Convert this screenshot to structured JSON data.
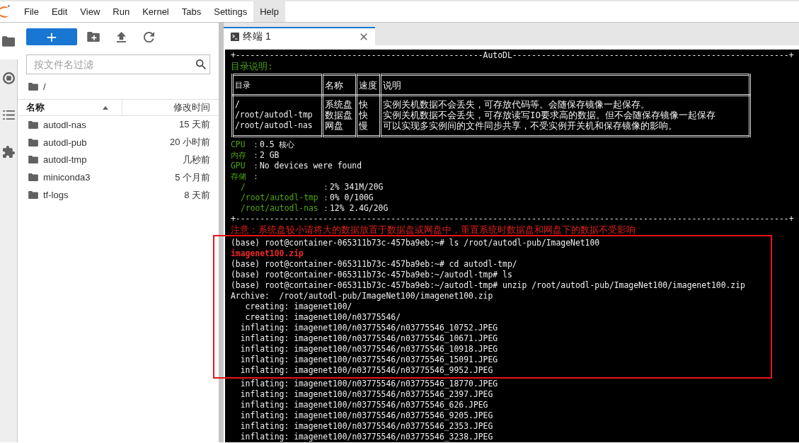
{
  "menu_bar": {
    "items": [
      {
        "label": "File",
        "selected": false
      },
      {
        "label": "Edit",
        "selected": false
      },
      {
        "label": "View",
        "selected": false
      },
      {
        "label": "Run",
        "selected": false
      },
      {
        "label": "Kernel",
        "selected": false
      },
      {
        "label": "Tabs",
        "selected": false
      },
      {
        "label": "Settings",
        "selected": false
      },
      {
        "label": "Help",
        "selected": true
      }
    ]
  },
  "side_tabs": [
    {
      "kind": "folder",
      "selected": true
    },
    {
      "kind": "stop",
      "selected": false
    },
    {
      "kind": "list",
      "selected": false
    },
    {
      "kind": "puzzle",
      "selected": false
    }
  ],
  "file_browser": {
    "new_button": {
      "label": "+"
    },
    "toolbar": [
      {
        "kind": "new-folder"
      },
      {
        "kind": "upload"
      },
      {
        "kind": "refresh"
      }
    ],
    "filter": {
      "placeholder": "按文件名过滤"
    },
    "breadcrumb": "/",
    "columns": [
      {
        "label": "名称",
        "sorted": true
      },
      {
        "label": "修改时间",
        "sorted": false
      }
    ],
    "rows": [
      {
        "name": "autodl-nas",
        "modified": "15 天前"
      },
      {
        "name": "autodl-pub",
        "modified": "20 小时前"
      },
      {
        "name": "autodl-tmp",
        "modified": "几秒前"
      },
      {
        "name": "miniconda3",
        "modified": "5 个月前"
      },
      {
        "name": "tf-logs",
        "modified": "8 天前"
      }
    ]
  },
  "terminal": {
    "tab": {
      "title": "终端 1",
      "selected": true
    },
    "banner_top": "+---------------------------------------------------AutoDL---------------------------------------------------------+",
    "heading": "目录说明:",
    "dir_table": {
      "columns": [
        "目录",
        "名称",
        "速度",
        "说明"
      ],
      "rows": [
        [
          "/",
          "系统盘",
          "快",
          "实例关机数据不会丢失，可存放代码等。会随保存镜像一起保存。"
        ],
        [
          "/root/autodl-tmp",
          "数据盘",
          "快",
          "实例关机数据不会丢失，可存放读写IO要求高的数据。但不会随保存镜像一起保存"
        ],
        [
          "/root/autodl-nas",
          "网盘",
          "慢",
          "可以实现多实例间的文件同步共享，不受实例开关机和保存镜像的影响。"
        ]
      ]
    },
    "specs": [
      {
        "label": "CPU",
        "value": "：0.5 核心"
      },
      {
        "label": "内存",
        "value": "：2 GB"
      },
      {
        "label": "GPU",
        "value": "：No devices were found"
      },
      {
        "label": "存储",
        "value": "："
      }
    ],
    "storage": [
      {
        "path": "/",
        "value": "：2% 341M/20G"
      },
      {
        "path": "/root/autodl-tmp",
        "value": "：0% 0/100G"
      },
      {
        "path": "/root/autodl-nas",
        "value": "：12% 2.4G/20G"
      }
    ],
    "banner_bottom": "+------------------------------------------------------------------------------------------------------------------+",
    "notice": "注意：系统盘较小请将大的数据放置于数据盘或网盘中，重置系统时数据盘和网盘下的数据不受影响",
    "output": [
      {
        "highlighted": true,
        "lines": [
          {
            "kind": "text",
            "text": "(base) root@container-065311b73c-457ba9eb:~# ls /root/autodl-pub/ImageNet100"
          },
          {
            "kind": "file",
            "text": "imagenet100.zip"
          },
          {
            "kind": "text",
            "text": "(base) root@container-065311b73c-457ba9eb:~# cd autodl-tmp/"
          },
          {
            "kind": "text",
            "text": "(base) root@container-065311b73c-457ba9eb:~/autodl-tmp# ls"
          },
          {
            "kind": "text",
            "text": "(base) root@container-065311b73c-457ba9eb:~/autodl-tmp# unzip /root/autodl-pub/ImageNet100/imagenet100.zip"
          },
          {
            "kind": "text",
            "text": "Archive:  /root/autodl-pub/ImageNet100/imagenet100.zip"
          },
          {
            "kind": "text",
            "text": "   creating: imagenet100/"
          },
          {
            "kind": "text",
            "text": "   creating: imagenet100/n03775546/"
          },
          {
            "kind": "text",
            "text": "  inflating: imagenet100/n03775546/n03775546_10752.JPEG"
          },
          {
            "kind": "text",
            "text": "  inflating: imagenet100/n03775546/n03775546_10671.JPEG"
          },
          {
            "kind": "text",
            "text": "  inflating: imagenet100/n03775546/n03775546_10918.JPEG"
          },
          {
            "kind": "text",
            "text": "  inflating: imagenet100/n03775546/n03775546_15091.JPEG"
          },
          {
            "kind": "text",
            "text": "  inflating: imagenet100/n03775546/n03775546_9952.JPEG"
          }
        ]
      },
      {
        "highlighted": false,
        "lines": [
          {
            "kind": "text",
            "text": "  inflating: imagenet100/n03775546/n03775546_18770.JPEG"
          },
          {
            "kind": "text",
            "text": "  inflating: imagenet100/n03775546/n03775546_2397.JPEG"
          },
          {
            "kind": "text",
            "text": "  inflating: imagenet100/n03775546/n03775546_626.JPEG"
          },
          {
            "kind": "text",
            "text": "  inflating: imagenet100/n03775546/n03775546_9205.JPEG"
          },
          {
            "kind": "text",
            "text": "  inflating: imagenet100/n03775546/n03775546_2353.JPEG"
          },
          {
            "kind": "text",
            "text": "  inflating: imagenet100/n03775546/n03775546_3238.JPEG"
          }
        ]
      }
    ]
  }
}
